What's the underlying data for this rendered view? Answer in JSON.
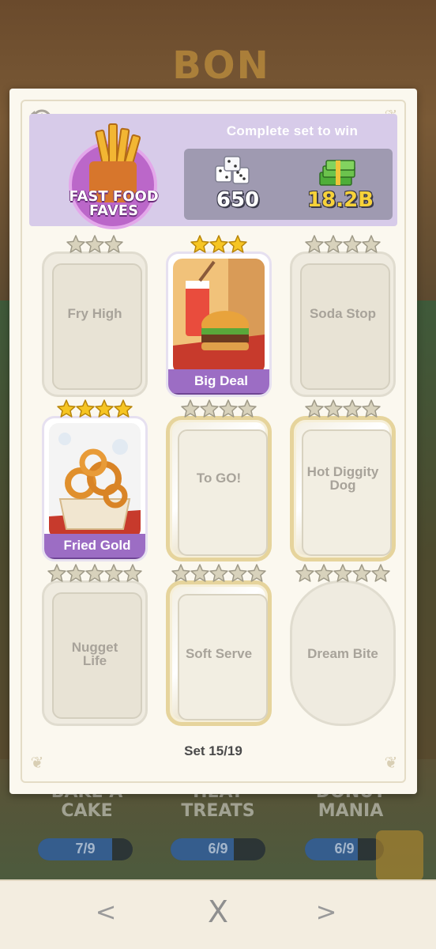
{
  "background": {
    "logo_text": "BON",
    "sets": [
      {
        "name": "BAKE A CAKE",
        "progress": "7/9",
        "fraction": 0.78
      },
      {
        "name": "HEAT TREATS",
        "progress": "6/9",
        "fraction": 0.67
      },
      {
        "name": "DONUT MANIA",
        "progress": "6/9",
        "fraction": 0.67
      }
    ]
  },
  "header": {
    "set_name_line1": "FAST FOOD",
    "set_name_line2": "FAVES",
    "complete_text": "Complete set to win",
    "reward_dice": "650",
    "reward_cash": "18.2B"
  },
  "cards": [
    {
      "name": "Fry High",
      "stars": 3,
      "owned": false,
      "gold": false
    },
    {
      "name": "Big Deal",
      "stars": 3,
      "owned": true,
      "gold": false
    },
    {
      "name": "Soda Stop",
      "stars": 4,
      "owned": false,
      "gold": false
    },
    {
      "name": "Fried Gold",
      "stars": 4,
      "owned": true,
      "gold": false
    },
    {
      "name": "To GO!",
      "stars": 4,
      "owned": false,
      "gold": true
    },
    {
      "name": "Hot Diggity Dog",
      "stars": 4,
      "owned": false,
      "gold": true
    },
    {
      "name": "Nugget Life",
      "stars": 5,
      "owned": false,
      "gold": false
    },
    {
      "name": "Soft Serve",
      "stars": 5,
      "owned": false,
      "gold": true
    },
    {
      "name": "Dream Bite",
      "stars": 5,
      "owned": false,
      "gold": false
    }
  ],
  "footer": {
    "set_counter": "Set 15/19"
  },
  "nav": {
    "prev": "<",
    "close": "X",
    "next": ">"
  },
  "colors": {
    "header_bg": "#d7cbe9",
    "reward_bg": "#9f9ab1",
    "owned_banner": "#9c6dc4",
    "star_gold": "#f6c523",
    "star_empty": "#d8d2bc"
  }
}
